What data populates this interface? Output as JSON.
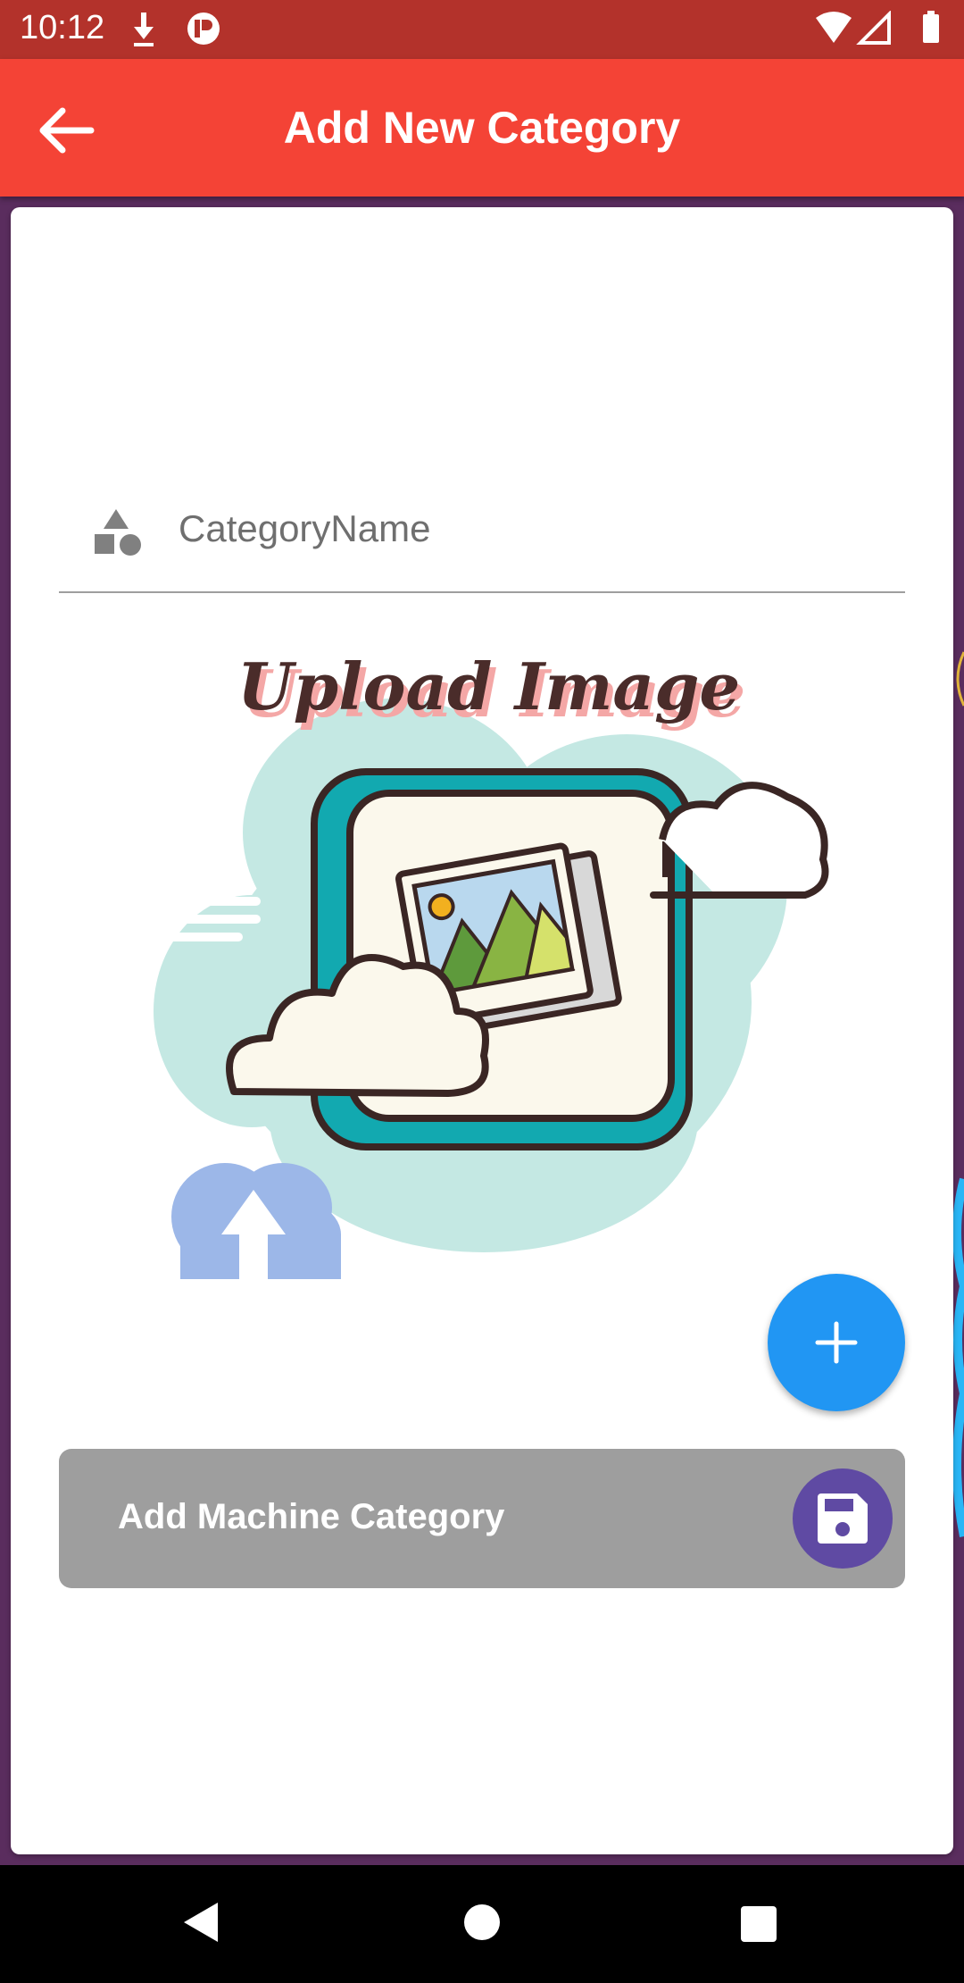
{
  "status_bar": {
    "time": "10:12",
    "icons": [
      "download-icon",
      "app-notification-icon",
      "wifi-icon",
      "signal-icon",
      "battery-icon"
    ]
  },
  "app_bar": {
    "title": "Add New Category",
    "back_icon": "arrow-back-icon"
  },
  "form": {
    "category_field": {
      "placeholder": "CategoryName",
      "value": "",
      "icon": "category-shapes-icon"
    },
    "upload_image": {
      "heading": "Upload Image",
      "icon": "upload-image-illustration"
    },
    "fab_icon": "plus-icon",
    "submit": {
      "label": "Add Machine Category",
      "icon": "save-icon"
    }
  },
  "nav_bar": {
    "icons": [
      "nav-back-icon",
      "nav-home-icon",
      "nav-recents-icon"
    ]
  },
  "colors": {
    "status_bar": "#b3322b",
    "app_bar": "#f44336",
    "fab": "#2196f3",
    "submit_button": "#9e9e9e",
    "save_circle": "#5f4aa3",
    "background": "#5a2d5e"
  }
}
